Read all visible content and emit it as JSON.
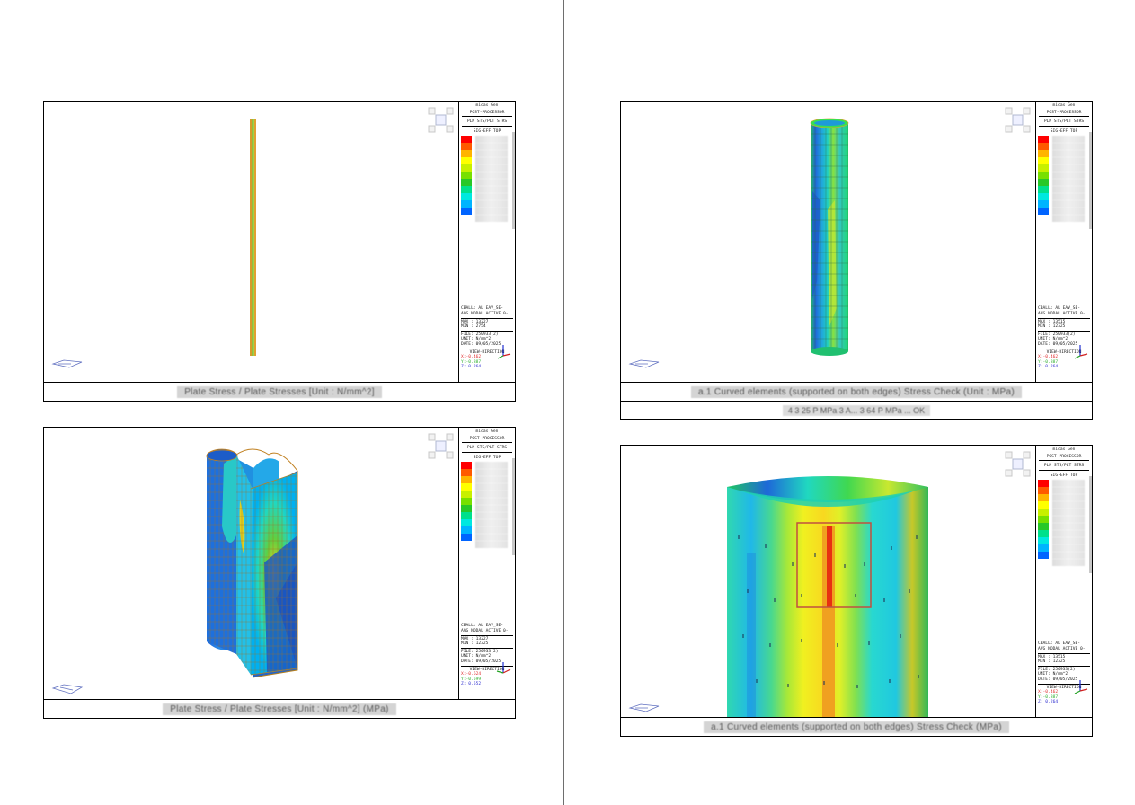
{
  "document": {
    "panels": [
      {
        "id": "p1",
        "caption": "Plate Stress / Plate Stresses [Unit : N/mm^2]",
        "legend": {
          "header1": "midas Gen",
          "header2": "POST-PROCESSOR",
          "header3": "PLN STS/PLT STRS",
          "header4": "SIG-EFF TOP",
          "calc": "CBALL: AL EAV_SE-",
          "calc2": "AVG NODAL ACTIVE 0-",
          "max": "MAX : 13227",
          "min": "MIN : 2754",
          "file": "FILE: 250933(2)",
          "unit": "UNIT: N/mm^2",
          "date": "DATE: 09/05/2025",
          "viewdir": "VIEW-DIRECTION",
          "x": "X:-0.462",
          "y": "Y:-0.887",
          "z": "Z: 0.264"
        }
      },
      {
        "id": "p2",
        "caption": "Plate Stress / Plate Stresses [Unit : N/mm^2] (MPa)",
        "legend": {
          "header1": "midas Gen",
          "header2": "POST-PROCESSOR",
          "header3": "PLN STS/PLT STRS",
          "header4": "SIG-EFF TOP",
          "calc": "CBALL: AL EAV_SE-",
          "calc2": "AVG NODAL ACTIVE 0-",
          "max": "MAX : 13227",
          "min": "MIN : 12325",
          "file": "FILE: 250933(2)",
          "unit": "UNIT: N/mm^2",
          "date": "DATE: 09/05/2025",
          "viewdir": "VIEW-DIRECTION",
          "x": "X:-0.624",
          "y": "Y:-0.599",
          "z": "Z: 0.552"
        }
      },
      {
        "id": "p3",
        "caption": "a.1 Curved elements (supported on both edges) Stress Check (Unit : MPa)",
        "subcaption": "4 3 25 P MPa 3 A... 3 64 P MPa ... OK",
        "legend": {
          "header1": "midas Gen",
          "header2": "POST-PROCESSOR",
          "header3": "PLN STS/PLT STRS",
          "header4": "SIG-EFF TOP",
          "calc": "CBALL: AL EAV_SE-",
          "calc2": "AVG NODAL ACTIVE 0-",
          "max": "MAX : 13515",
          "min": "MIN : 12325",
          "file": "FILE: 250933(2)",
          "unit": "UNIT: N/mm^2",
          "date": "DATE: 09/05/2025",
          "viewdir": "VIEW-DIRECTION",
          "x": "X:-0.462",
          "y": "Y:-0.887",
          "z": "Z: 0.264"
        }
      },
      {
        "id": "p4",
        "caption": "a.1 Curved elements (supported on both edges) Stress Check (MPa)",
        "legend": {
          "header1": "midas Gen",
          "header2": "POST-PROCESSOR",
          "header3": "PLN STS/PLT STRS",
          "header4": "SIG-EFF TOP",
          "calc": "CBALL: AL EAV_SE-",
          "calc2": "AVG NODAL ACTIVE 0-",
          "max": "MAX : 13515",
          "min": "MIN : 12325",
          "file": "FILE: 250933(2)",
          "unit": "UNIT: N/mm^2",
          "date": "DATE: 09/05/2025",
          "viewdir": "VIEW-DIRECTION",
          "x": "X:-0.462",
          "y": "Y:-0.887",
          "z": "Z: 0.264"
        }
      }
    ],
    "colors": {
      "scale": [
        "#ff0000",
        "#ff5a00",
        "#ffb400",
        "#ffff00",
        "#c8f000",
        "#78e000",
        "#28c828",
        "#00e08c",
        "#00e8e0",
        "#00b4ff",
        "#0064ff"
      ]
    }
  }
}
